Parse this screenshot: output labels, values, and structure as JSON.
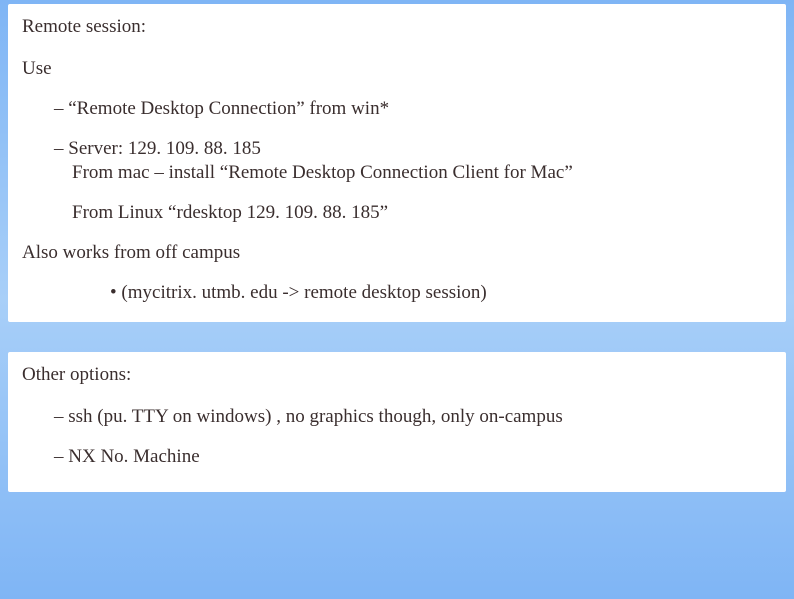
{
  "box1": {
    "heading": "Remote session:",
    "use_label": "Use",
    "items": [
      "“Remote Desktop Connection” from win*",
      "Server: 129. 109. 88. 185"
    ],
    "sublines": [
      "From mac – install “Remote Desktop Connection Client for Mac”",
      "From Linux “rdesktop 129. 109. 88. 185”"
    ],
    "also_works": "Also works from off campus",
    "bullet": "(mycitrix. utmb. edu -> remote desktop session)"
  },
  "box2": {
    "heading": "Other options:",
    "items": [
      "ssh (pu. TTY on windows) , no graphics though, only on-campus",
      "NX No. Machine"
    ]
  }
}
